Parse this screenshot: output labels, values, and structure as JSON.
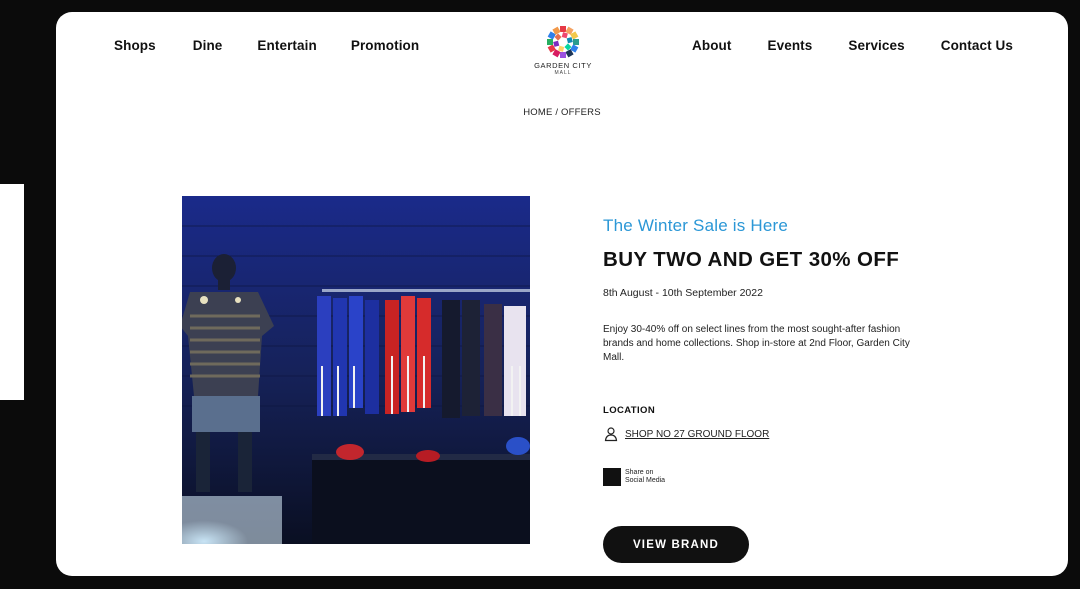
{
  "nav": {
    "left": [
      "Shops",
      "Dine",
      "Entertain",
      "Promotion"
    ],
    "right": [
      "About",
      "Events",
      "Services",
      "Contact Us"
    ]
  },
  "logo": {
    "name": "GARDEN CITY",
    "sub": "MALL"
  },
  "breadcrumb": {
    "home": "HOME",
    "separator": "/",
    "current": "OFFERS"
  },
  "offer": {
    "kicker": "The Winter Sale is Here",
    "title": "BUY TWO AND GET 30% OFF",
    "dates": "8th August - 10th September 2022",
    "description": "Enjoy 30-40% off on select lines from the most sought-after fashion brands and home collections. Shop in-store at 2nd Floor, Garden City Mall.",
    "location_label": "LOCATION",
    "location": "SHOP NO 27 GROUND FLOOR",
    "share_line1": "Share on",
    "share_line2": "Social Media",
    "cta": "VIEW BRAND"
  },
  "colors": {
    "accent": "#2b97d6",
    "primary": "#111111",
    "background": "#ffffff"
  },
  "icons": [
    "person-pin-icon"
  ]
}
